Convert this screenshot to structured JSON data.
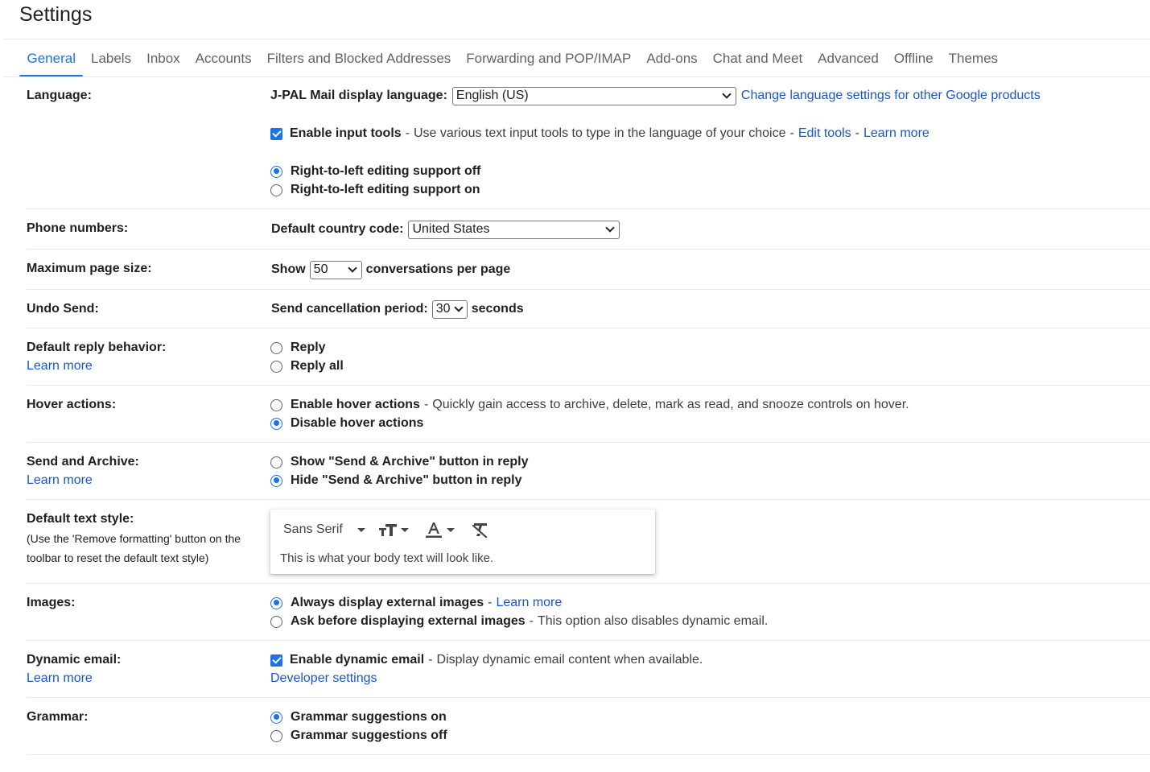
{
  "page": {
    "title": "Settings"
  },
  "tabs": [
    {
      "label": "General",
      "active": true
    },
    {
      "label": "Labels"
    },
    {
      "label": "Inbox"
    },
    {
      "label": "Accounts"
    },
    {
      "label": "Filters and Blocked Addresses"
    },
    {
      "label": "Forwarding and POP/IMAP"
    },
    {
      "label": "Add-ons"
    },
    {
      "label": "Chat and Meet"
    },
    {
      "label": "Advanced"
    },
    {
      "label": "Offline"
    },
    {
      "label": "Themes"
    }
  ],
  "language": {
    "label": "Language:",
    "display_label": "J-PAL Mail display language:",
    "display_value": "English (US)",
    "change_link": "Change language settings for other Google products",
    "input_tools_label": "Enable input tools",
    "input_tools_checked": true,
    "input_tools_desc": "Use various text input tools to type in the language of your choice",
    "edit_tools": "Edit tools",
    "learn_more": "Learn more",
    "rtl_off": "Right-to-left editing support off",
    "rtl_on": "Right-to-left editing support on",
    "rtl_selected": "off"
  },
  "phone": {
    "label": "Phone numbers:",
    "country_label": "Default country code:",
    "country_value": "United States"
  },
  "page_size": {
    "label": "Maximum page size:",
    "show": "Show",
    "value": "50",
    "suffix": "conversations per page"
  },
  "undo_send": {
    "label": "Undo Send:",
    "period_label": "Send cancellation period:",
    "value": "30",
    "suffix": "seconds"
  },
  "reply": {
    "label": "Default reply behavior:",
    "learn_more": "Learn more",
    "reply": "Reply",
    "reply_all": "Reply all"
  },
  "hover": {
    "label": "Hover actions:",
    "enable": "Enable hover actions",
    "enable_desc": "Quickly gain access to archive, delete, mark as read, and snooze controls on hover.",
    "disable": "Disable hover actions",
    "selected": "disable"
  },
  "send_archive": {
    "label": "Send and Archive:",
    "learn_more": "Learn more",
    "show": "Show \"Send & Archive\" button in reply",
    "hide": "Hide \"Send & Archive\" button in reply",
    "selected": "hide"
  },
  "text_style": {
    "label": "Default text style:",
    "hint_line1": "(Use the 'Remove formatting' button on the",
    "hint_line2": "toolbar to reset the default text style)",
    "font": "Sans Serif",
    "sample": "This is what your body text will look like."
  },
  "images": {
    "label": "Images:",
    "always": "Always display external images",
    "learn_more": "Learn more",
    "ask": "Ask before displaying external images",
    "ask_desc": "This option also disables dynamic email.",
    "selected": "always"
  },
  "dynamic": {
    "label": "Dynamic email:",
    "learn_more": "Learn more",
    "enable": "Enable dynamic email",
    "enable_desc": "Display dynamic email content when available.",
    "checked": true,
    "developer": "Developer settings"
  },
  "grammar": {
    "label": "Grammar:",
    "on": "Grammar suggestions on",
    "off": "Grammar suggestions off",
    "selected": "on"
  },
  "colors": {
    "accent": "#1a73e8",
    "link": "#1a57c5",
    "divider": "#e8eaed"
  }
}
